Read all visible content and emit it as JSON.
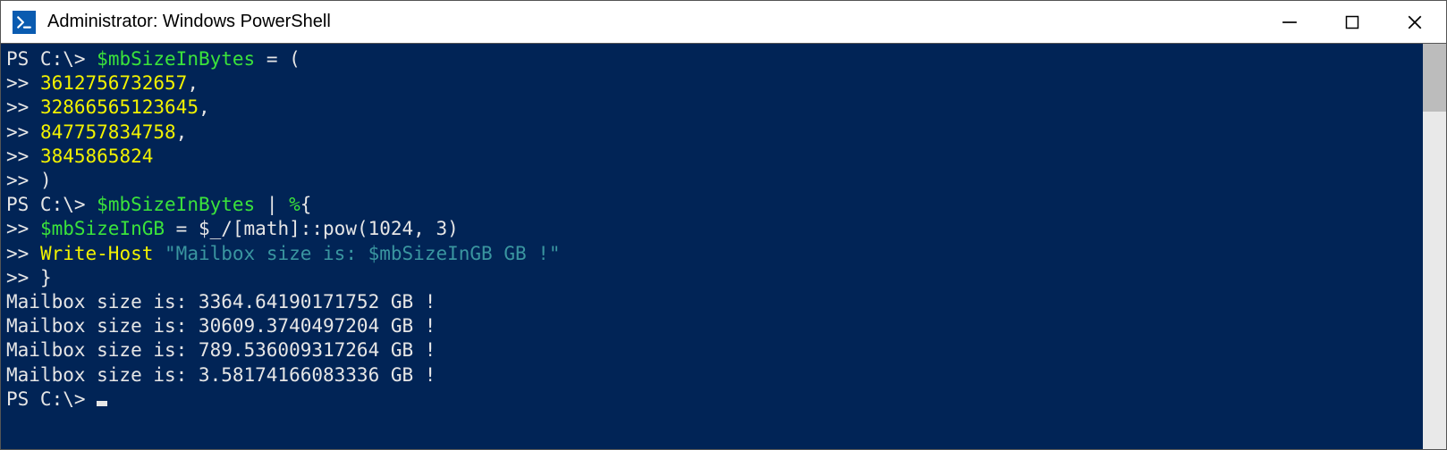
{
  "window": {
    "title": "Administrator: Windows PowerShell"
  },
  "colors": {
    "terminal_bg": "#012456",
    "text_default": "#e6e6e6",
    "text_yellow": "#f2f200",
    "text_green": "#3be33b",
    "text_cyan": "#3a96a0"
  },
  "terminal": {
    "prompt": "PS C:\\>",
    "cont": ">>",
    "var_name": "$mbSizeInBytes",
    "eq_open": " = (",
    "arr_vals": [
      "3612756732657",
      "32866565123645",
      "847757834758",
      "3845865824"
    ],
    "comma": ",",
    "close_paren": ")",
    "pipe_expr_pre": " | ",
    "pipe_pct": "%",
    "brace_open": "{",
    "assign_lhs": "$mbSizeInGB",
    "assign_eq_pipe": " = $_/",
    "math_expr": "[math]::pow(1024, 3)",
    "write_host": "Write-Host",
    "string_open": " \"Mailbox size is: ",
    "string_var": "$mbSizeInGB",
    "string_close": " GB !\"",
    "brace_close": "}",
    "outputs": [
      "Mailbox size is: 3364.64190171752 GB !",
      "Mailbox size is: 30609.3740497204 GB !",
      "Mailbox size is: 789.536009317264 GB !",
      "Mailbox size is: 3.58174166083336 GB !"
    ]
  }
}
